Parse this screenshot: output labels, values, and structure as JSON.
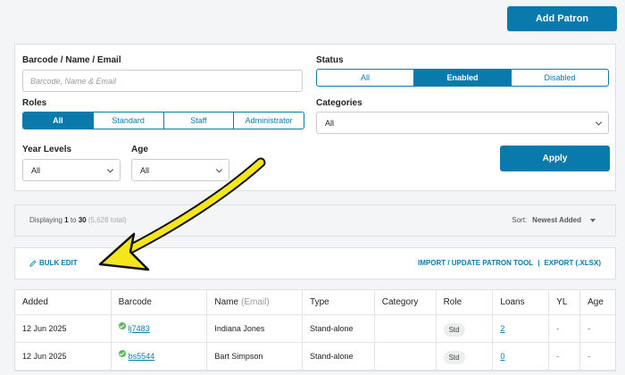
{
  "header": {
    "add_patron": "Add Patron"
  },
  "filters": {
    "search_label": "Barcode / Name / Email",
    "search_placeholder": "Barcode, Name & Email",
    "status_label": "Status",
    "status_options": [
      "All",
      "Enabled",
      "Disabled"
    ],
    "status_selected": "Enabled",
    "roles_label": "Roles",
    "roles_options": [
      "All",
      "Standard",
      "Staff",
      "Administrator"
    ],
    "roles_selected": "All",
    "categories_label": "Categories",
    "categories_value": "All",
    "year_levels_label": "Year Levels",
    "year_levels_value": "All",
    "age_label": "Age",
    "age_value": "All",
    "apply": "Apply"
  },
  "summary": {
    "displaying_prefix": "Displaying",
    "range_start": "1",
    "to": "to",
    "range_end": "30",
    "total": "(5,628 total)",
    "sort_label": "Sort:",
    "sort_value": "Newest Added"
  },
  "actions": {
    "bulk_edit": "BULK EDIT",
    "import": "IMPORT / UPDATE PATRON TOOL",
    "separator": "|",
    "export": "EXPORT (.XLSX)"
  },
  "table": {
    "headers": {
      "added": "Added",
      "barcode": "Barcode",
      "name": "Name",
      "name_hint": "(Email)",
      "type": "Type",
      "category": "Category",
      "role": "Role",
      "loans": "Loans",
      "yl": "YL",
      "age": "Age"
    },
    "rows": [
      {
        "added": "12 Jun 2025",
        "barcode": "lj7483",
        "name": "Indiana Jones",
        "type": "Stand-alone",
        "category": "",
        "role": "Std",
        "loans": "2",
        "yl": "-",
        "age": "-"
      },
      {
        "added": "12 Jun 2025",
        "barcode": "bs5544",
        "name": "Bart Simpson",
        "type": "Stand-alone",
        "category": "",
        "role": "Std",
        "loans": "0",
        "yl": "-",
        "age": "-"
      }
    ]
  },
  "colors": {
    "accent": "#0a7aac",
    "annotation_arrow": "#f5e61c",
    "ok": "#5cb85c"
  }
}
